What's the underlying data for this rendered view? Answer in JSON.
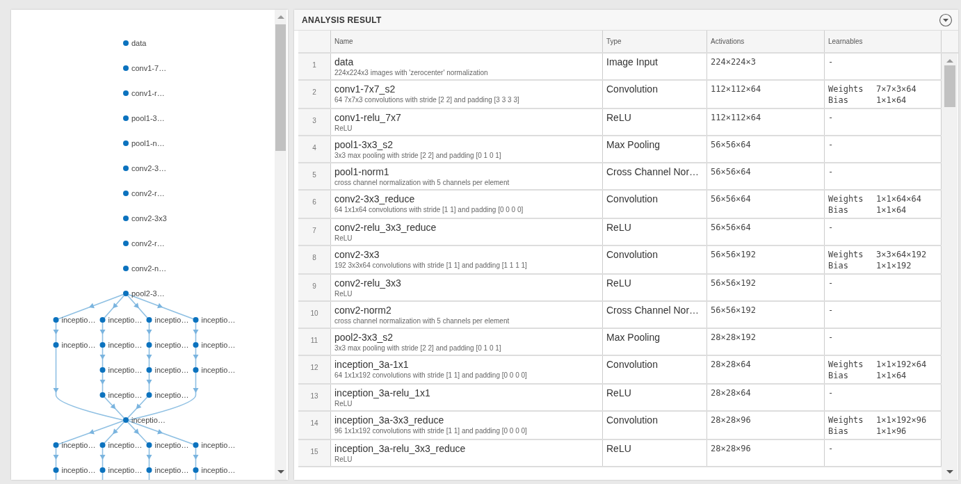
{
  "graph": {
    "chain": [
      "data",
      "conv1-7…",
      "conv1-r…",
      "pool1-3…",
      "pool1-n…",
      "conv2-3…",
      "conv2-r…",
      "conv2-3x3",
      "conv2-r…",
      "conv2-n…",
      "pool2-3…"
    ],
    "block": {
      "branches": [
        [
          "inceptio…",
          "inceptio…"
        ],
        [
          "inceptio…",
          "inceptio…",
          "inceptio…",
          "inceptio…"
        ],
        [
          "inceptio…",
          "inceptio…",
          "inceptio…",
          "inceptio…"
        ],
        [
          "inceptio…",
          "inceptio…",
          "inceptio…"
        ]
      ],
      "merge": "inceptio…"
    },
    "next_branches": [
      [
        "inceptio…",
        "inceptio…"
      ],
      [
        "inceptio…",
        "inceptio…"
      ],
      [
        "inceptio…",
        "inceptio…"
      ],
      [
        "inceptio…",
        "inceptio…"
      ]
    ]
  },
  "analysis": {
    "title": "ANALYSIS RESULT",
    "columns": [
      "Name",
      "Type",
      "Activations",
      "Learnables"
    ],
    "rows": [
      {
        "index": "1",
        "name": "data",
        "description": "224x224x3 images with 'zerocenter' normalization",
        "type": "Image Input",
        "activations": "224×224×3",
        "learnables": "-"
      },
      {
        "index": "2",
        "name": "conv1-7x7_s2",
        "description": "64 7x7x3 convolutions with stride [2 2] and padding [3 3 3 3]",
        "type": "Convolution",
        "activations": "112×112×64",
        "learnables": [
          {
            "name": "Weights",
            "size": "7×7×3×64"
          },
          {
            "name": "Bias",
            "size": "1×1×64"
          }
        ]
      },
      {
        "index": "3",
        "name": "conv1-relu_7x7",
        "description": "ReLU",
        "type": "ReLU",
        "activations": "112×112×64",
        "learnables": "-"
      },
      {
        "index": "4",
        "name": "pool1-3x3_s2",
        "description": "3x3 max pooling with stride [2 2] and padding [0 1 0 1]",
        "type": "Max Pooling",
        "activations": "56×56×64",
        "learnables": "-"
      },
      {
        "index": "5",
        "name": "pool1-norm1",
        "description": "cross channel normalization with 5 channels per element",
        "type": "Cross Channel Nor…",
        "activations": "56×56×64",
        "learnables": "-"
      },
      {
        "index": "6",
        "name": "conv2-3x3_reduce",
        "description": "64 1x1x64 convolutions with stride [1 1] and padding [0 0 0 0]",
        "type": "Convolution",
        "activations": "56×56×64",
        "learnables": [
          {
            "name": "Weights",
            "size": "1×1×64×64"
          },
          {
            "name": "Bias",
            "size": "1×1×64"
          }
        ]
      },
      {
        "index": "7",
        "name": "conv2-relu_3x3_reduce",
        "description": "ReLU",
        "type": "ReLU",
        "activations": "56×56×64",
        "learnables": "-"
      },
      {
        "index": "8",
        "name": "conv2-3x3",
        "description": "192 3x3x64 convolutions with stride [1 1] and padding [1 1 1 1]",
        "type": "Convolution",
        "activations": "56×56×192",
        "learnables": [
          {
            "name": "Weights",
            "size": "3×3×64×192"
          },
          {
            "name": "Bias",
            "size": "1×1×192"
          }
        ]
      },
      {
        "index": "9",
        "name": "conv2-relu_3x3",
        "description": "ReLU",
        "type": "ReLU",
        "activations": "56×56×192",
        "learnables": "-"
      },
      {
        "index": "10",
        "name": "conv2-norm2",
        "description": "cross channel normalization with 5 channels per element",
        "type": "Cross Channel Nor…",
        "activations": "56×56×192",
        "learnables": "-"
      },
      {
        "index": "11",
        "name": "pool2-3x3_s2",
        "description": "3x3 max pooling with stride [2 2] and padding [0 1 0 1]",
        "type": "Max Pooling",
        "activations": "28×28×192",
        "learnables": "-"
      },
      {
        "index": "12",
        "name": "inception_3a-1x1",
        "description": "64 1x1x192 convolutions with stride [1 1] and padding [0 0 0 0]",
        "type": "Convolution",
        "activations": "28×28×64",
        "learnables": [
          {
            "name": "Weights",
            "size": "1×1×192×64"
          },
          {
            "name": "Bias",
            "size": "1×1×64"
          }
        ]
      },
      {
        "index": "13",
        "name": "inception_3a-relu_1x1",
        "description": "ReLU",
        "type": "ReLU",
        "activations": "28×28×64",
        "learnables": "-"
      },
      {
        "index": "14",
        "name": "inception_3a-3x3_reduce",
        "description": "96 1x1x192 convolutions with stride [1 1] and padding [0 0 0 0]",
        "type": "Convolution",
        "activations": "28×28×96",
        "learnables": [
          {
            "name": "Weights",
            "size": "1×1×192×96"
          },
          {
            "name": "Bias",
            "size": "1×1×96"
          }
        ]
      },
      {
        "index": "15",
        "name": "inception_3a-relu_3x3_reduce",
        "description": "ReLU",
        "type": "ReLU",
        "activations": "28×28×96",
        "learnables": "-"
      }
    ]
  }
}
